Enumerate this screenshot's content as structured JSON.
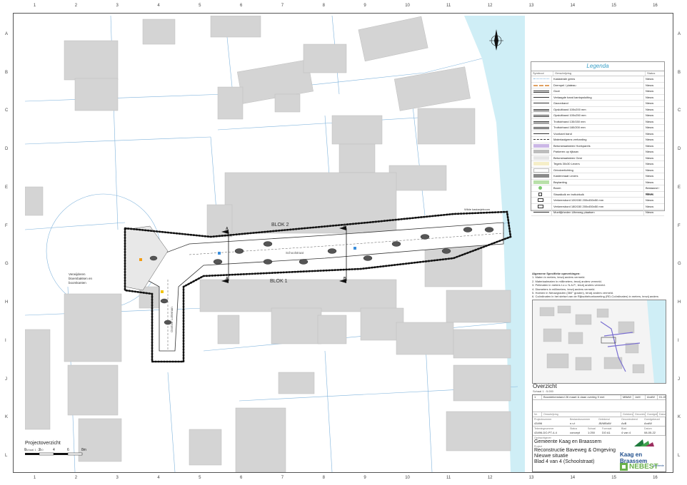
{
  "colors": {
    "water": "#cfeef6",
    "building": "#d4d4d4",
    "parcel_line": "#7fb3dc",
    "street": "#ffffff",
    "fence": "#111111",
    "legend_title": "#3aa0c8",
    "nebest_green": "#6ab04c",
    "kaag_red": "#c0392b"
  },
  "grid": {
    "columns": [
      "1",
      "2",
      "3",
      "4",
      "5",
      "6",
      "7",
      "8",
      "9",
      "10",
      "11",
      "12",
      "13",
      "14",
      "15",
      "16"
    ],
    "rows": [
      "A",
      "B",
      "C",
      "D",
      "E",
      "F",
      "G",
      "H",
      "I",
      "J",
      "K",
      "L"
    ]
  },
  "plan": {
    "blok2_label": "BLOK 2",
    "blok1_label": "BLOK 1",
    "section_a": "A",
    "section_b": "B",
    "street_label": "Schoolstraat",
    "side_street_label": "Oostvor Lotteman",
    "annotation_left": "Verwijderen\nbloembakken en\nboomkanten",
    "annotation_toprt": "Wilde kastanjeboom"
  },
  "legend": {
    "title": "Legenda",
    "col_symbol": "Symbool",
    "col_desc": "Omschrijving",
    "col_status": "Status",
    "items": [
      {
        "desc": "Kadastrale grens",
        "status": "Nieuw",
        "icon": "dotted-line"
      },
      {
        "desc": "Drempel / plateau",
        "status": "Nieuw",
        "icon": "hatch-line"
      },
      {
        "desc": "Goot",
        "status": "Nieuw",
        "icon": "double-line"
      },
      {
        "desc": "Verlaagde band kantopsluiting",
        "status": "Nieuw",
        "icon": "thin-line"
      },
      {
        "desc": "Gazonband",
        "status": "Nieuw",
        "icon": "thin-line"
      },
      {
        "desc": "Opsluitband 100x200 mm",
        "status": "Nieuw",
        "icon": "double-line"
      },
      {
        "desc": "Opsluitband 100x250 mm",
        "status": "Nieuw",
        "icon": "double-line"
      },
      {
        "desc": "Trottoirband 130/150 mm",
        "status": "Nieuw",
        "icon": "double-line"
      },
      {
        "desc": "Trottoirband 180/200 mm",
        "status": "Nieuw",
        "icon": "double-line"
      },
      {
        "desc": "Voorkant band",
        "status": "Nieuw",
        "icon": "thin-line"
      },
      {
        "desc": "Materiaalgrens verharding",
        "status": "Nieuw",
        "icon": "dashed-line"
      },
      {
        "desc": "Betonstraatsteen Hoekparels",
        "status": "Nieuw",
        "icon": "fill-lavender"
      },
      {
        "desc": "Parkeren op rijbaan",
        "status": "Nieuw",
        "icon": "fill-grey"
      },
      {
        "desc": "Betonstraatsteen Gest",
        "status": "Nieuw",
        "icon": "fill-lightgrey"
      },
      {
        "desc": "Tegels 30x30 Lexers",
        "status": "Nieuw",
        "icon": "fill-cream"
      },
      {
        "desc": "Grindverlichting",
        "status": "Nieuw",
        "icon": "fill-white"
      },
      {
        "desc": "Kastenmaat Lexers",
        "status": "Nieuw",
        "icon": "fill-darkgrey"
      },
      {
        "desc": "Beplanting",
        "status": "Nieuw",
        "icon": "fill-green"
      },
      {
        "desc": "Boom",
        "status": "Bestaand / nieuw",
        "icon": "tree"
      },
      {
        "desc": "Straatkolk en trottoirkolk",
        "status": "Nieuw",
        "icon": "gully"
      },
      {
        "desc": "Verkeersbord 100/150 200x450x50 mm",
        "status": "Nieuw",
        "icon": "sign"
      },
      {
        "desc": "Verkeersbord 180/150 200x450x50 mm",
        "status": "Nieuw",
        "icon": "sign"
      },
      {
        "desc": "Moeilijkheden Uiterweg plaatsen",
        "status": "Nieuw",
        "icon": "thin-line"
      }
    ]
  },
  "remarks": {
    "title": "Algemene Specifieke opmerkingen:",
    "lines": [
      "1.  Maten in meters, tenzij anders vermeld.",
      "2.  Materiaalmaten in millimeters, tenzij anders vermeld.",
      "3.  Peilmaten in meters t.o.v. N.A.P., tenzij anders vermeld.",
      "4.  Diameters in millimeters, tenzij anders vermeld.",
      "5.  Hoeken in Nieuwgraden (360° graden), tenzij anders vermeld.",
      "6.  Coördinaten in het stelsel van de Rijksdriehoeksmeting (RD-Coördinaten) in meters, tenzij anders vermeld."
    ]
  },
  "overview": {
    "title": "Overzicht",
    "scale": "Schaal 1 : 5.000"
  },
  "title_block": {
    "revision_line": "Bouwtekenstand 26 maart & daan overleg 9 mei",
    "rev_who1": "MBdW",
    "rev_who2": "JoM",
    "rev_who3": "AndW",
    "rev_date": "01-05-22",
    "col_nr": "Nr.",
    "col_omschrijving": "Omschrijving",
    "col_getekend": "Getekend",
    "col_gecontroleerd": "Gecontroleerd",
    "col_goedgekeurd": "Goedgekeurd",
    "col_datum": "Datum",
    "projectnr_label": "Projectnummer",
    "projectnr": "43496",
    "bestand_label": "Bestandsnummer",
    "bestand": "n.v.t",
    "tekening_label": "Tekeningnummer",
    "tekening": "43496-DO-PT-4-4",
    "status_label": "Status",
    "status": "concept",
    "schaal_label": "Schaal",
    "schaal": "1:250",
    "formaat_label": "Formaat",
    "formaat": "DO A1",
    "getekend_val": "JB/MBdW",
    "gecontroleerd_val": "AxB",
    "goedgekeurd_val": "AndW",
    "datum_val": "08-05-22",
    "blad_label": "Blad",
    "blad_val": "4 van 4",
    "opdrachtgever_label": "Opdrachtgever",
    "opdrachtgever": "Gemeente Kaag en Braassem",
    "project_label": "Project",
    "project_line1": "Reconstructie Baveweg & Omgeving",
    "project_line2": "Nieuwe situatie",
    "project_line3": "Blad 4 van 4 (Schoolstraat)",
    "logo_kaag": "Kaag en Braassem",
    "logo_kaag_sub": "gemeente",
    "logo_nebest": "NEBEST"
  },
  "project_overview": {
    "title": "Projectoverzicht",
    "scale": "Schaal 1 : 200",
    "scalebar_ticks": [
      "0",
      "2",
      "4",
      "6",
      "8m"
    ]
  }
}
